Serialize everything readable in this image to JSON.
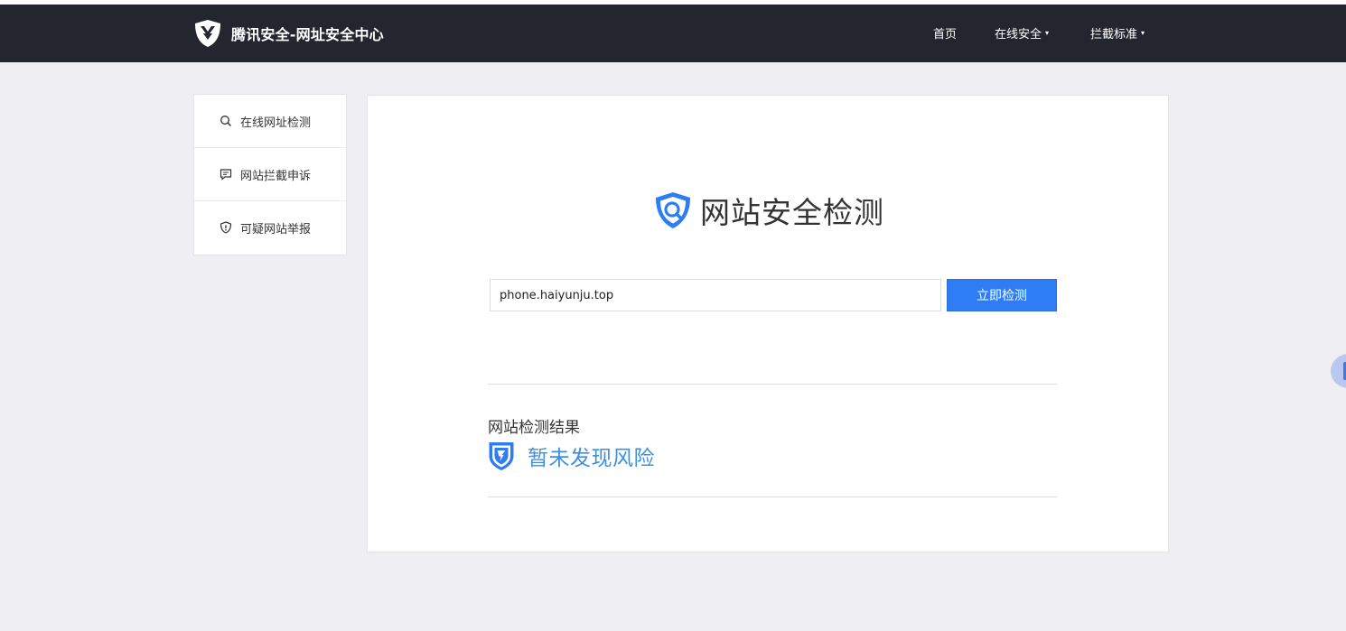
{
  "brand": {
    "title": "腾讯安全-网址安全中心",
    "icon": "shield-logo-icon"
  },
  "nav": {
    "items": [
      {
        "label": "首页",
        "has_dropdown": false
      },
      {
        "label": "在线安全",
        "has_dropdown": true
      },
      {
        "label": "拦截标准",
        "has_dropdown": true
      }
    ],
    "caret": "▾"
  },
  "sidebar": {
    "items": [
      {
        "label": "在线网址检测",
        "icon": "search-icon"
      },
      {
        "label": "网站拦截申诉",
        "icon": "chat-icon"
      },
      {
        "label": "可疑网站举报",
        "icon": "alert-shield-icon"
      }
    ]
  },
  "main": {
    "title": "网站安全检测",
    "search": {
      "value": "phone.haiyunju.top",
      "button_label": "立即检测"
    },
    "result": {
      "label": "网站检测结果",
      "status": "暂未发现风险",
      "status_color": "#3e8fe0"
    }
  },
  "colors": {
    "navbar": "#23252f",
    "accent": "#2e7df5",
    "background": "#eeeef3"
  }
}
